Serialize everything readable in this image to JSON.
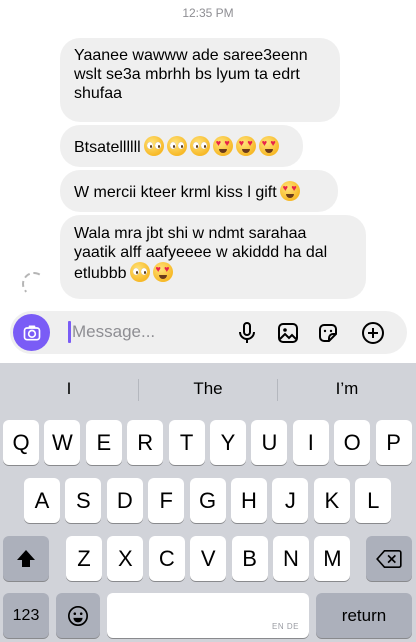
{
  "chat": {
    "timestamp": "12:35 PM",
    "messages": [
      {
        "text": "Yaanee wawww ade saree3eenn\nwslt se3a mbrhh bs lyum ta edrt\nshufaa",
        "emoji": []
      },
      {
        "text": "Btsatellllll",
        "emoji": [
          "pleading-face",
          "pleading-face",
          "pleading-face",
          "heart-eyes-face",
          "heart-eyes-face",
          "heart-eyes-face"
        ]
      },
      {
        "text": "W mercii kteer krml kiss l gift",
        "emoji": [
          "heart-eyes-face"
        ]
      },
      {
        "text": "Wala mra jbt shi w ndmt sarahaa\nyaatik alff aafyeeee w akiddd ha dal\netlubbb",
        "emoji": [
          "pleading-face",
          "heart-eyes-face"
        ]
      }
    ]
  },
  "composer": {
    "placeholder": "Message...",
    "camera_icon": "camera-icon",
    "mic_icon": "microphone-icon",
    "gallery_icon": "gallery-icon",
    "sticker_icon": "sticker-icon",
    "plus_icon": "plus-icon",
    "accent_color": "#7a5cf6"
  },
  "keyboard": {
    "suggestions": [
      "I",
      "The",
      "I’m"
    ],
    "row1": [
      "Q",
      "W",
      "E",
      "R",
      "T",
      "Y",
      "U",
      "I",
      "O",
      "P"
    ],
    "row2": [
      "A",
      "S",
      "D",
      "F",
      "G",
      "H",
      "J",
      "K",
      "L"
    ],
    "row3": [
      "Z",
      "X",
      "C",
      "V",
      "B",
      "N",
      "M"
    ],
    "shift_icon": "shift-icon",
    "backspace_icon": "backspace-icon",
    "numbers_label": "123",
    "emoji_icon": "emoji-icon",
    "space_hint": "EN DE",
    "return_label": "return"
  }
}
